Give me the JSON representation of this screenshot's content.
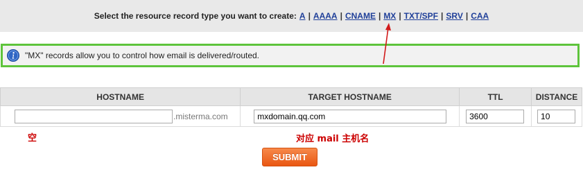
{
  "type_bar": {
    "prompt": "Select the resource record type you want to create:",
    "types": [
      "A",
      "AAAA",
      "CNAME",
      "MX",
      "TXT/SPF",
      "SRV",
      "CAA"
    ],
    "separator": "|"
  },
  "info": {
    "message": "\"MX\" records allow you to control how email is delivered/routed.",
    "icon": "info-icon"
  },
  "table": {
    "headers": [
      "HOSTNAME",
      "TARGET HOSTNAME",
      "TTL",
      "DISTANCE"
    ],
    "hostname_value": "",
    "hostname_suffix": ".misterma.com",
    "target_value": "mxdomain.qq.com",
    "ttl_value": "3600",
    "distance_value": "10"
  },
  "annotations": {
    "hostname_note": "空",
    "target_note": "对应 mail 主机名"
  },
  "submit_label": "SUBMIT",
  "colors": {
    "highlight_border": "#5ec43c",
    "annotation": "#cc0000",
    "link": "#1f3f99",
    "submit": "#e95712"
  }
}
